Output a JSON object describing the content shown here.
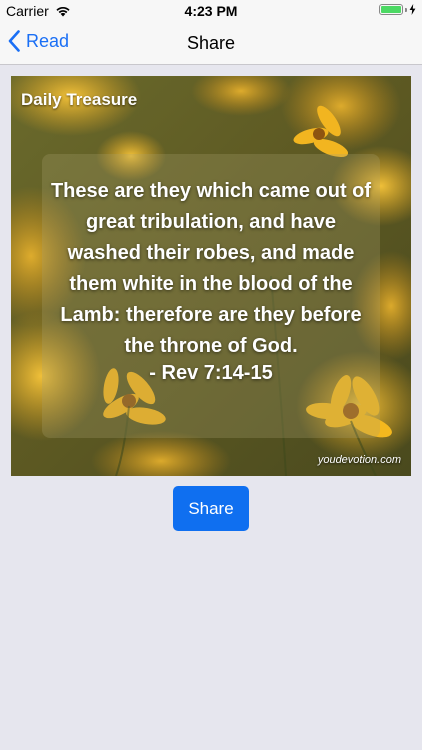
{
  "status_bar": {
    "carrier": "Carrier",
    "time": "4:23 PM",
    "battery_level": 1.0,
    "battery_color": "#4cd964"
  },
  "nav": {
    "back_label": "Read",
    "title": "Share",
    "accent_color": "#1a6ff5"
  },
  "card": {
    "brand": "Daily Treasure",
    "verse": "These are they which came out of great tribulation, and have washed their robes, and made them white in the blood of the Lamb: therefore are they before the throne of God.",
    "reference": "- Rev 7:14-15",
    "watermark": "youdevotion.com",
    "background_image": "yellow-flowers-photo"
  },
  "share_button": {
    "label": "Share",
    "color": "#0f6ff0"
  }
}
